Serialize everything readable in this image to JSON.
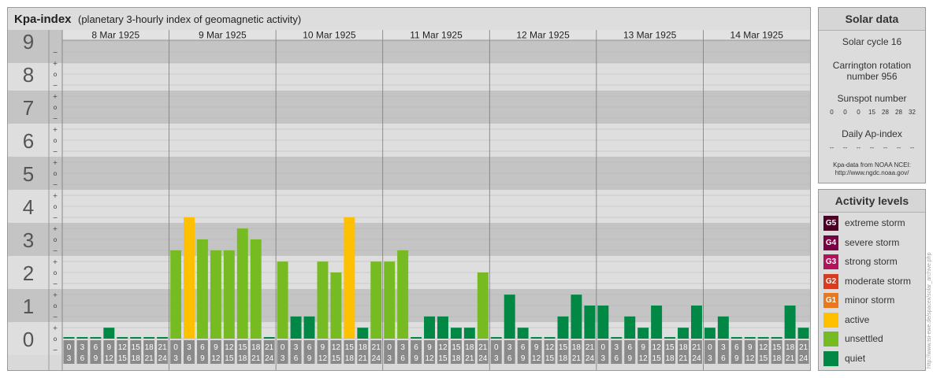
{
  "title": {
    "bold": "Kpa-index",
    "subtitle": "(planetary 3-hourly index of geomagnetic activity)"
  },
  "chart_data": {
    "type": "bar",
    "title": "Kpa-index",
    "ylim": [
      0,
      9
    ],
    "y_major_ticks": [
      "0",
      "1",
      "2",
      "3",
      "4",
      "5",
      "6",
      "7",
      "8",
      "9"
    ],
    "y_minor_labels": [
      "o",
      "+",
      "−"
    ],
    "days": [
      "8 Mar 1925",
      "9 Mar 1925",
      "10 Mar 1925",
      "11 Mar 1925",
      "12 Mar 1925",
      "13 Mar 1925",
      "14 Mar 1925"
    ],
    "interval_labels": [
      [
        "0",
        "3"
      ],
      [
        "3",
        "6"
      ],
      [
        "6",
        "9"
      ],
      [
        "9",
        "12"
      ],
      [
        "12",
        "15"
      ],
      [
        "15",
        "18"
      ],
      [
        "18",
        "21"
      ],
      [
        "21",
        "24"
      ]
    ],
    "values": [
      0,
      0,
      0,
      0.33,
      0,
      0,
      0,
      0,
      2.67,
      3.67,
      3,
      2.67,
      2.67,
      3.33,
      3,
      0,
      2.33,
      0.67,
      0.67,
      2.33,
      2,
      3.67,
      0.33,
      2.33,
      2.33,
      2.67,
      0,
      0.67,
      0.67,
      0.33,
      0.33,
      2,
      0,
      1.33,
      0.33,
      0,
      0,
      0.67,
      1.33,
      1,
      1,
      0,
      0.67,
      0.33,
      1,
      0,
      0.33,
      1,
      0.33,
      0.67,
      0,
      0,
      0,
      0,
      1,
      0.33
    ],
    "levels": [
      "quiet",
      "quiet",
      "quiet",
      "quiet",
      "quiet",
      "quiet",
      "quiet",
      "quiet",
      "unsettled",
      "active",
      "unsettled",
      "unsettled",
      "unsettled",
      "unsettled",
      "unsettled",
      "quiet",
      "unsettled",
      "quiet",
      "quiet",
      "unsettled",
      "unsettled",
      "active",
      "quiet",
      "unsettled",
      "unsettled",
      "unsettled",
      "quiet",
      "quiet",
      "quiet",
      "quiet",
      "quiet",
      "unsettled",
      "quiet",
      "quiet",
      "quiet",
      "quiet",
      "quiet",
      "quiet",
      "quiet",
      "quiet",
      "quiet",
      "quiet",
      "quiet",
      "quiet",
      "quiet",
      "quiet",
      "quiet",
      "quiet",
      "quiet",
      "quiet",
      "quiet",
      "quiet",
      "quiet",
      "quiet",
      "quiet",
      "quiet"
    ],
    "colors": {
      "quiet": "#008844",
      "unsettled": "#77bb22",
      "active": "#ffc000"
    }
  },
  "solar": {
    "heading": "Solar data",
    "cycle": "Solar cycle 16",
    "carrington_1": "Carrington rotation",
    "carrington_2": "number 956",
    "sunspot_label": "Sunspot number",
    "sunspot_values": [
      "0",
      "0",
      "0",
      "15",
      "28",
      "28",
      "32"
    ],
    "ap_label": "Daily Ap-index",
    "ap_values": [
      "--",
      "--",
      "--",
      "--",
      "--",
      "--",
      "--"
    ],
    "source_1": "Kpa-data from NOAA NCEI:",
    "source_2": "http://www.ngdc.noaa.gov/"
  },
  "activity": {
    "heading": "Activity levels",
    "items": [
      {
        "badge": "G5",
        "label": "extreme storm",
        "color": "#4d0026"
      },
      {
        "badge": "G4",
        "label": "severe storm",
        "color": "#7a0044"
      },
      {
        "badge": "G3",
        "label": "strong storm",
        "color": "#b0145a"
      },
      {
        "badge": "G2",
        "label": "moderate storm",
        "color": "#d83c1e"
      },
      {
        "badge": "G1",
        "label": "minor storm",
        "color": "#e87820"
      },
      {
        "badge": "",
        "label": "active",
        "color": "#ffc000"
      },
      {
        "badge": "",
        "label": "unsettled",
        "color": "#77bb22"
      },
      {
        "badge": "",
        "label": "quiet",
        "color": "#008844"
      }
    ]
  },
  "watermark": "http://www.tsi-ewe.de/spacex/solar_archive.php"
}
